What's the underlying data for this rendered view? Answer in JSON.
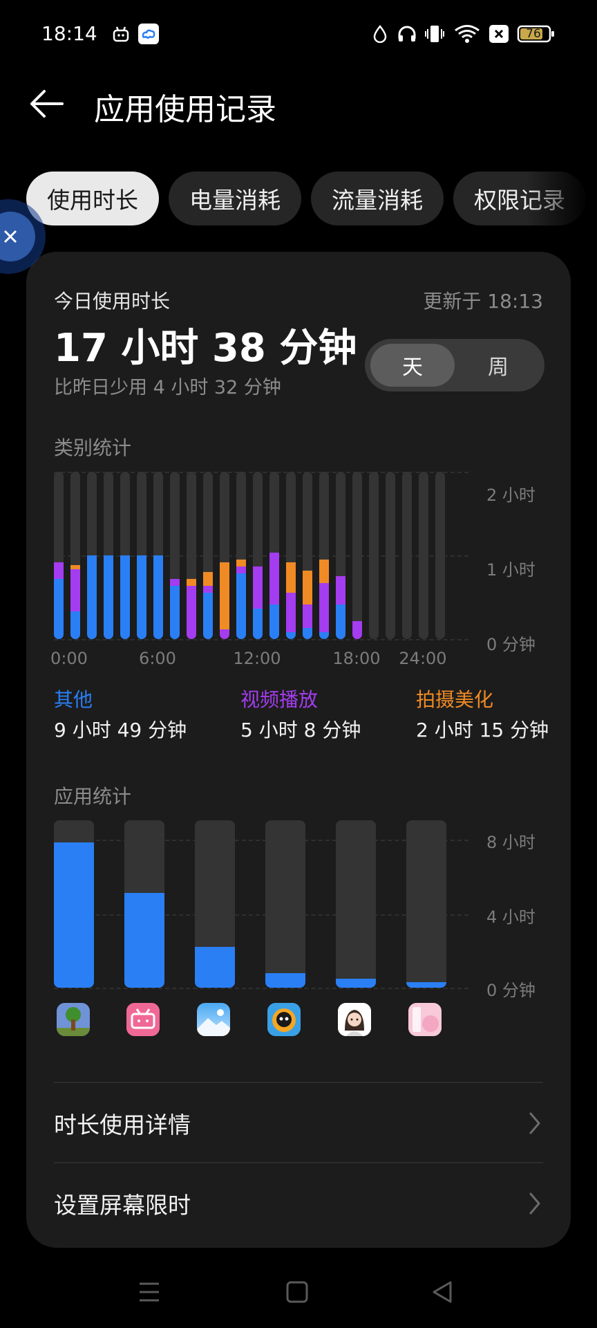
{
  "status_bar": {
    "time": "18:14",
    "left_icons": [
      "android-bot-icon",
      "cloud-app-icon"
    ],
    "right_icons": [
      "water-drop-icon",
      "headphones-icon",
      "vibrate-icon",
      "wifi-icon",
      "sim-x-icon",
      "battery-icon"
    ],
    "battery_level": "76"
  },
  "header": {
    "title": "应用使用记录",
    "back_icon": "arrow-left-icon"
  },
  "tabs": [
    {
      "label": "使用时长",
      "active": true
    },
    {
      "label": "电量消耗",
      "active": false
    },
    {
      "label": "流量消耗",
      "active": false
    },
    {
      "label": "权限记录",
      "active": false
    }
  ],
  "summary": {
    "label": "今日使用时长",
    "updated": "更新于 18:13",
    "total": "17 小时 38 分钟",
    "compare": "比昨日少用 4 小时 32 分钟",
    "toggle": {
      "day": "天",
      "week": "周",
      "selected": "天"
    }
  },
  "category_chart": {
    "section_title": "类别统计",
    "y_ticks": [
      "2 小时",
      "1 小时",
      "0 分钟"
    ],
    "x_ticks": [
      "0:00",
      "6:00",
      "12:00",
      "18:00",
      "24:00"
    ],
    "colors": {
      "other": "#2a7ff5",
      "video": "#a43cf0",
      "camera": "#f08a24",
      "empty": "#343434"
    },
    "legend": [
      {
        "name": "其他",
        "value": "9 小时 49 分钟",
        "color": "#2a7ff5"
      },
      {
        "name": "视频播放",
        "value": "5 小时 8 分钟",
        "color": "#a43cf0"
      },
      {
        "name": "拍摄美化",
        "value": "2 小时 15 分钟",
        "color": "#f08a24"
      }
    ]
  },
  "chart_data": {
    "type": "bar",
    "stacked": true,
    "ylim_minutes": [
      0,
      120
    ],
    "categories": [
      "0",
      "1",
      "2",
      "3",
      "4",
      "5",
      "6",
      "7",
      "8",
      "9",
      "10",
      "11",
      "12",
      "13",
      "14",
      "15",
      "16",
      "17",
      "18",
      "19",
      "20",
      "21",
      "22",
      "23"
    ],
    "series": [
      {
        "name": "其他",
        "color": "#2a7ff5",
        "values": [
          43,
          20,
          60,
          60,
          60,
          60,
          60,
          38,
          0,
          33,
          0,
          47,
          22,
          25,
          5,
          8,
          5,
          25,
          0,
          0,
          0,
          0,
          0,
          0
        ]
      },
      {
        "name": "视频播放",
        "color": "#a43cf0",
        "values": [
          12,
          30,
          0,
          0,
          0,
          0,
          0,
          5,
          38,
          5,
          7,
          5,
          30,
          37,
          28,
          17,
          35,
          20,
          13,
          0,
          0,
          0,
          0,
          0
        ]
      },
      {
        "name": "拍摄美化",
        "color": "#f08a24",
        "values": [
          0,
          3,
          0,
          0,
          0,
          0,
          0,
          0,
          5,
          10,
          48,
          5,
          0,
          0,
          22,
          24,
          17,
          0,
          0,
          0,
          0,
          0,
          0,
          0
        ]
      }
    ]
  },
  "app_chart": {
    "section_title": "应用统计",
    "y_ticks": [
      "8 小时",
      "4 小时",
      "0 分钟"
    ],
    "y_max_hours": 9,
    "apps": [
      {
        "icon": "terraria-tree-icon",
        "hours": 7.8
      },
      {
        "icon": "bilibili-icon",
        "hours": 5.1
      },
      {
        "icon": "gallery-icon",
        "hours": 2.2
      },
      {
        "icon": "yellow-character-app-icon",
        "hours": 0.8
      },
      {
        "icon": "avatar-app-icon",
        "hours": 0.5
      },
      {
        "icon": "pink-comic-app-icon",
        "hours": 0.3
      }
    ]
  },
  "list": [
    {
      "label": "时长使用详情",
      "icon": "chevron-right-icon"
    },
    {
      "label": "设置屏幕限时",
      "icon": "chevron-right-icon"
    }
  ],
  "nav_bar": [
    "menu-lines-icon",
    "home-square-icon",
    "back-triangle-icon"
  ]
}
